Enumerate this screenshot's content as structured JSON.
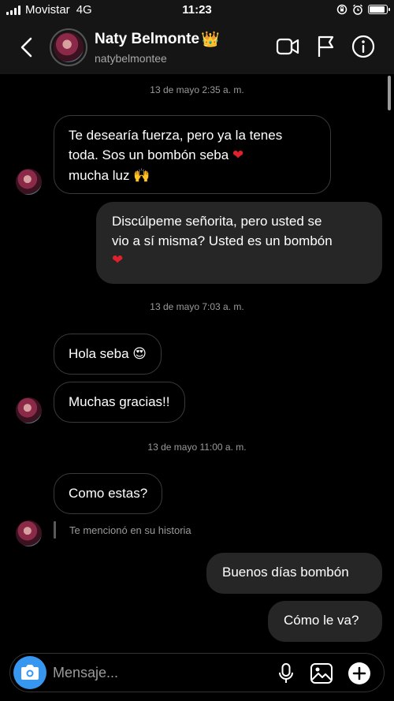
{
  "status_bar": {
    "carrier": "Movistar",
    "network": "4G",
    "time": "11:23",
    "battery_level": 0.9
  },
  "header": {
    "name": "Naty Belmonte",
    "badge_emoji": "👑",
    "username": "natybelmontee",
    "icons": [
      "back-chevron-icon",
      "video-call-icon",
      "flag-icon",
      "info-icon"
    ]
  },
  "thread": {
    "timestamps": [
      "13 de mayo 2:35 a. m.",
      "13 de mayo 7:03 a. m.",
      "13 de mayo 11:00 a. m."
    ],
    "msg1": {
      "line1": "Te desearía fuerza, pero ya la tenes",
      "line2": "toda. Sos un bombón seba",
      "line2_emoji": "❤",
      "line3": "mucha luz",
      "line3_emoji": "🙌"
    },
    "msg2": {
      "line1": "Discúlpeme señorita, pero usted se",
      "line2": "vio a sí misma? Usted es un bombón",
      "line3_emoji": "❤"
    },
    "msg3": {
      "text": "Hola seba",
      "emoji": "😍"
    },
    "msg4": {
      "text": "Muchas gracias!!"
    },
    "msg5": {
      "text": "Como estas?"
    },
    "story_mention": "Te mencionó en su historia",
    "msg6": {
      "text": "Buenos días bombón"
    },
    "msg7": {
      "text": "Cómo le va?"
    }
  },
  "composer": {
    "placeholder": "Mensaje...",
    "accent": "#3797f0",
    "icons": [
      "camera-icon",
      "microphone-icon",
      "gallery-icon",
      "add-icon"
    ]
  }
}
